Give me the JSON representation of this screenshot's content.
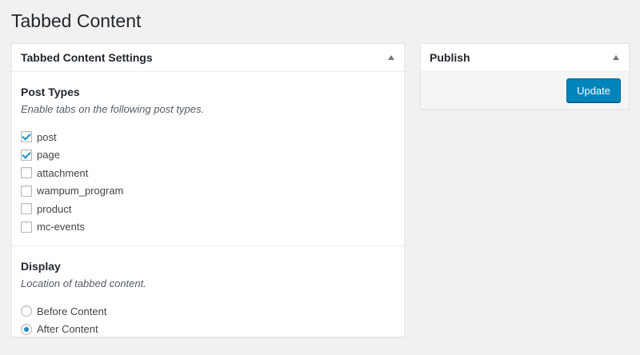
{
  "page": {
    "title": "Tabbed Content"
  },
  "settings_box": {
    "title": "Tabbed Content Settings",
    "post_types": {
      "heading": "Post Types",
      "description": "Enable tabs on the following post types.",
      "options": [
        {
          "label": "post",
          "checked": true
        },
        {
          "label": "page",
          "checked": true
        },
        {
          "label": "attachment",
          "checked": false
        },
        {
          "label": "wampum_program",
          "checked": false
        },
        {
          "label": "product",
          "checked": false
        },
        {
          "label": "mc-events",
          "checked": false
        }
      ]
    },
    "display": {
      "heading": "Display",
      "description": "Location of tabbed content.",
      "options": [
        {
          "label": "Before Content",
          "selected": false
        },
        {
          "label": "After Content",
          "selected": true
        }
      ]
    }
  },
  "publish_box": {
    "title": "Publish",
    "update_label": "Update"
  },
  "icons": {
    "toggle": "arrow-up-icon"
  },
  "colors": {
    "accent": "#0085ba",
    "check": "#1e8cbe",
    "background": "#f1f1f1"
  }
}
